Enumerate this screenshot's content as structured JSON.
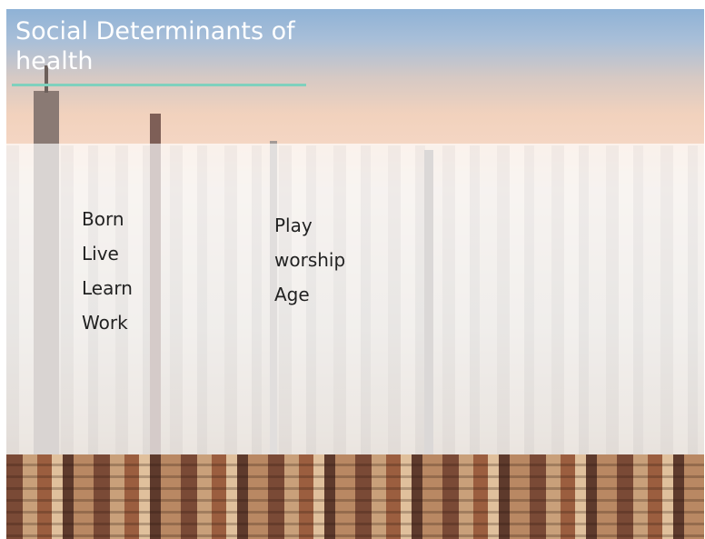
{
  "slide": {
    "title": "Social Determinants of health",
    "accent_color": "#7fd1bd",
    "background": "city-skyline-photo",
    "columns": {
      "left": [
        "Born",
        "Live",
        "Learn",
        "Work"
      ],
      "right": [
        "Play",
        "worship",
        "Age"
      ]
    }
  }
}
